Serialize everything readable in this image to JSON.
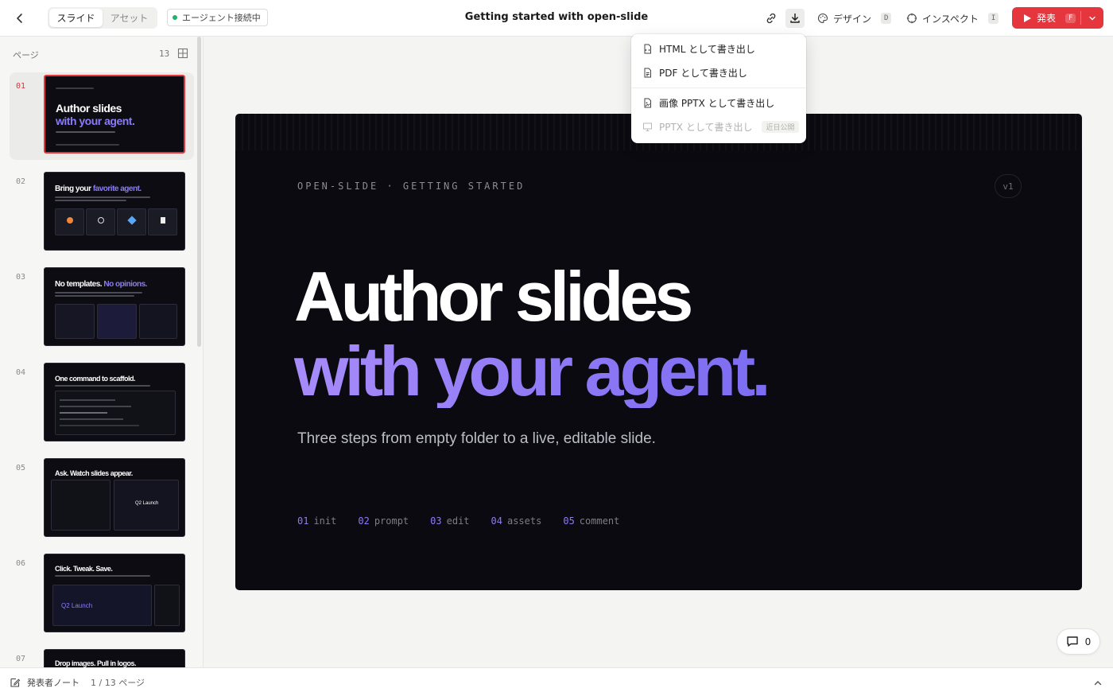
{
  "topbar": {
    "tabs": [
      {
        "label": "スライド"
      },
      {
        "label": "アセット"
      }
    ],
    "agent_status": "エージェント接続中",
    "doc_title": "Getting started with open-slide",
    "design": {
      "label": "デザイン",
      "shortcut": "D"
    },
    "inspect": {
      "label": "インスペクト",
      "shortcut": "I"
    },
    "present": {
      "label": "発表",
      "shortcut": "F"
    }
  },
  "sidebar": {
    "label": "ページ",
    "count": "13",
    "thumbnails": [
      {
        "num": "01",
        "title_a": "Author slides",
        "title_b": "with your agent."
      },
      {
        "num": "02",
        "title_a": "Bring your ",
        "title_b": "favorite agent."
      },
      {
        "num": "03",
        "title_a": "No templates. ",
        "title_b": "No opinions."
      },
      {
        "num": "04",
        "title_a": "One command to scaffold.",
        "title_b": ""
      },
      {
        "num": "05",
        "title_a": "Ask. Watch slides appear.",
        "title_b": "",
        "card": "Q2 Launch"
      },
      {
        "num": "06",
        "title_a": "Click. Tweak. Save.",
        "title_b": "",
        "card": "Q2 Launch"
      },
      {
        "num": "07",
        "title_a": "Drop images. Pull in logos.",
        "title_b": ""
      }
    ]
  },
  "slide": {
    "eyebrow": "OPEN-SLIDE · GETTING STARTED",
    "version": "v1",
    "headline_1": "Author slides",
    "headline_2": "with your agent.",
    "subtitle": "Three steps from empty folder to a live, editable slide.",
    "steps": [
      {
        "num": "01",
        "label": "init"
      },
      {
        "num": "02",
        "label": "prompt"
      },
      {
        "num": "03",
        "label": "edit"
      },
      {
        "num": "04",
        "label": "assets"
      },
      {
        "num": "05",
        "label": "comment"
      }
    ]
  },
  "export_menu": {
    "items": [
      {
        "label": "HTML として書き出し",
        "icon": "html-file-icon"
      },
      {
        "label": "PDF として書き出し",
        "icon": "pdf-file-icon"
      },
      {
        "label": "画像 PPTX として書き出し",
        "icon": "image-file-icon"
      },
      {
        "label": "PPTX として書き出し",
        "icon": "presentation-icon",
        "badge": "近日公開",
        "disabled": true
      }
    ]
  },
  "comments": {
    "count": "0"
  },
  "bottombar": {
    "notes_label": "発表者ノート",
    "page_status": "1 / 13 ページ"
  },
  "colors": {
    "accent": "#e5363e",
    "brand_purple": "#8b7cf6",
    "slide_bg": "#0a0a10",
    "status_green": "#22b368"
  }
}
